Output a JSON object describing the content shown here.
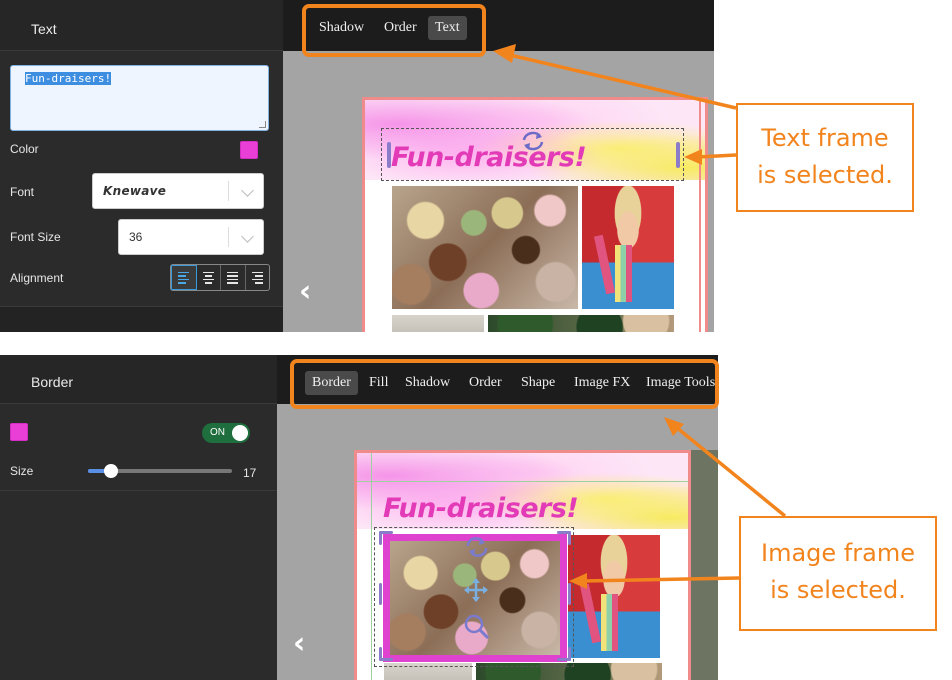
{
  "top_screenshot": {
    "sidebar": {
      "header_title": "Text",
      "text_value": "Fun-draisers!",
      "color_label": "Color",
      "color_value": "#ea3fd6",
      "font_label": "Font",
      "font_value": "Knewave",
      "font_size_label": "Font Size",
      "font_size_value": "36",
      "alignment_label": "Alignment",
      "alignment_options": [
        "align-left",
        "align-center",
        "justify",
        "align-right"
      ],
      "alignment_selected": "align-left"
    },
    "toolbar": {
      "buttons": [
        "Shadow",
        "Order",
        "Text"
      ],
      "active": "Text"
    },
    "canvas": {
      "page_title": "Fun-draisers!",
      "prev_arrow": "‹"
    }
  },
  "bottom_screenshot": {
    "sidebar": {
      "header_title": "Border",
      "color_value": "#ea3fd6",
      "toggle_label": "ON",
      "toggle_on": true,
      "size_label": "Size",
      "size_value": "17",
      "size_fraction": 0.16
    },
    "toolbar": {
      "buttons": [
        "Border",
        "Fill",
        "Shadow",
        "Order",
        "Shape",
        "Image FX",
        "Image Tools"
      ],
      "active": "Border"
    },
    "canvas": {
      "page_title": "Fun-draisers!",
      "prev_arrow": "‹"
    }
  },
  "annotations": {
    "text_callout": [
      "Text frame",
      "is selected."
    ],
    "image_callout": [
      "Image frame",
      "is selected."
    ],
    "accent_color": "#f2841e"
  }
}
